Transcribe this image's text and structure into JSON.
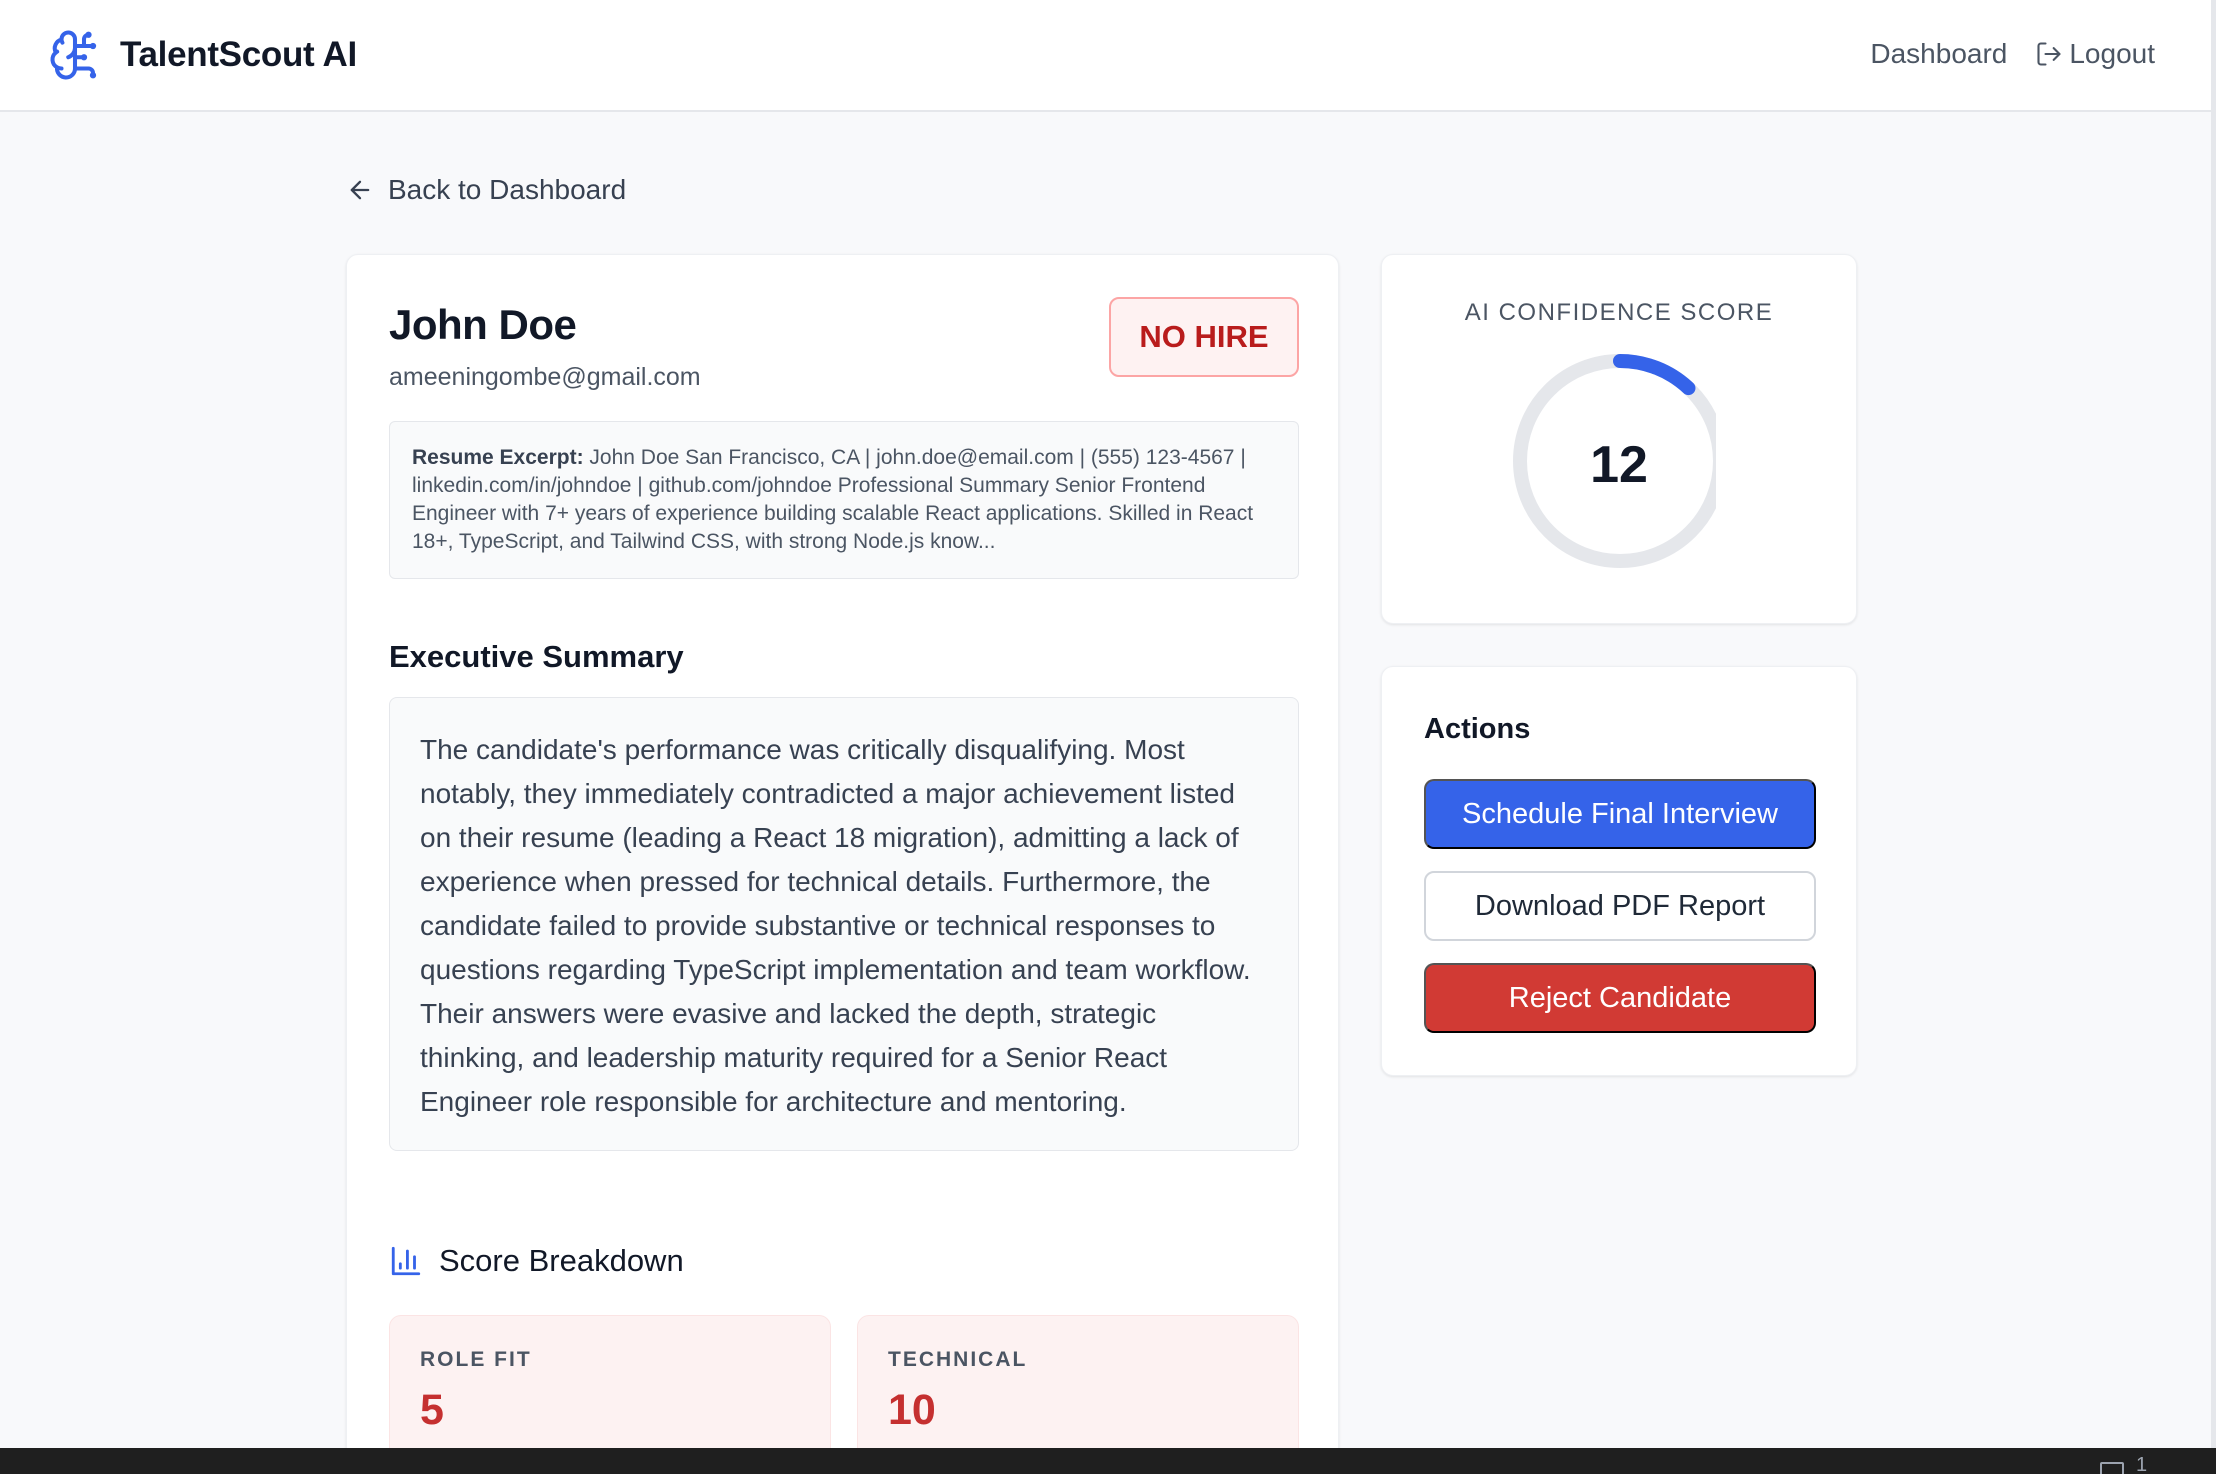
{
  "header": {
    "brand": "TalentScout AI",
    "nav": {
      "dashboard": "Dashboard",
      "logout": "Logout"
    }
  },
  "back_link": "Back to Dashboard",
  "candidate": {
    "name": "John Doe",
    "email": "ameeningombe@gmail.com",
    "verdict": "NO HIRE",
    "resume_label": "Resume Excerpt:",
    "resume_text": " John Doe San Francisco, CA | john.doe@email.com | (555) 123-4567 | linkedin.com/in/johndoe | github.com/johndoe Professional Summary Senior Frontend Engineer with 7+ years of experience building scalable React applications. Skilled in React 18+, TypeScript, and Tailwind CSS, with strong Node.js know..."
  },
  "executive_summary": {
    "title": "Executive Summary",
    "text": "The candidate's performance was critically disqualifying. Most notably, they immediately contradicted a major achievement listed on their resume (leading a React 18 migration), admitting a lack of experience when pressed for technical details. Furthermore, the candidate failed to provide substantive or technical responses to questions regarding TypeScript implementation and team workflow. Their answers were evasive and lacked the depth, strategic thinking, and leadership maturity required for a Senior React Engineer role responsible for architecture and mentoring."
  },
  "score_breakdown": {
    "title": "Score Breakdown",
    "metrics": [
      {
        "label": "ROLE FIT",
        "value": "5"
      },
      {
        "label": "TECHNICAL",
        "value": "10"
      }
    ]
  },
  "confidence": {
    "label": "AI CONFIDENCE SCORE",
    "score": 12,
    "score_text": "12"
  },
  "actions": {
    "title": "Actions",
    "schedule": "Schedule Final Interview",
    "download": "Download PDF Report",
    "reject": "Reject Candidate"
  },
  "status_bar": {
    "text": "1"
  },
  "colors": {
    "accent": "#3563e9",
    "danger": "#d13a34",
    "verdict_text": "#b91c1c",
    "metric_value": "#c53030"
  }
}
